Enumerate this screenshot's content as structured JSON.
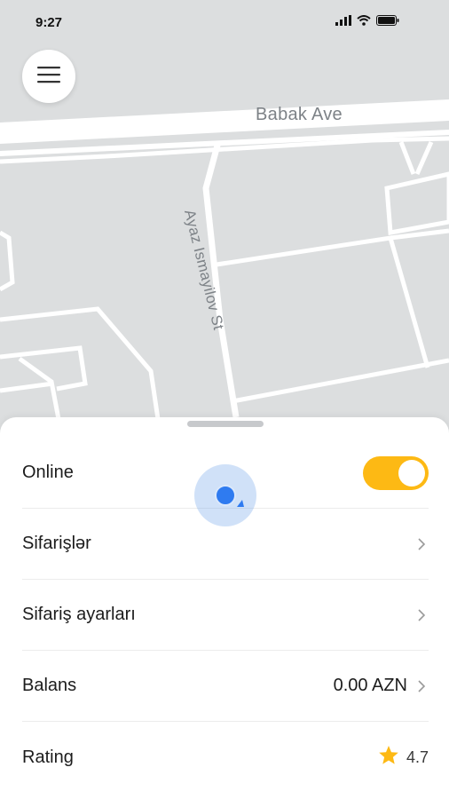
{
  "status_bar": {
    "time": "9:27"
  },
  "map": {
    "streets": {
      "babak": "Babak Ave",
      "ayaz": "Ayaz Ismayilov St"
    }
  },
  "menu": {
    "icon": "hamburger-icon"
  },
  "sheet": {
    "rows": [
      {
        "label": "Online",
        "control": "toggle",
        "toggle_on": true
      },
      {
        "label": "Sifarişlər",
        "control": "chevron"
      },
      {
        "label": "Sifariş ayarları",
        "control": "chevron"
      },
      {
        "label": "Balans",
        "value": "0.00 AZN",
        "control": "chevron"
      },
      {
        "label": "Rating",
        "value": "4.7",
        "icon": "star-icon"
      }
    ]
  },
  "colors": {
    "accent": "#fdb914",
    "map_background": "#dcdedf",
    "location_blue": "#2f7bf0",
    "star": "#fdb914"
  }
}
